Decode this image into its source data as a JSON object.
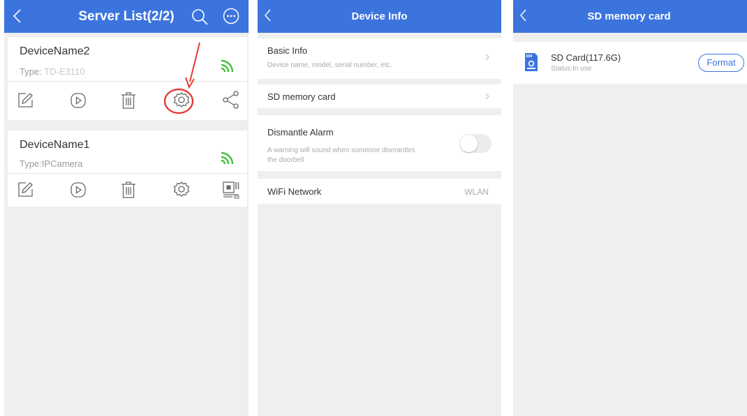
{
  "colors": {
    "accent": "#3c74de",
    "signal": "#3fbf3f",
    "highlight": "#e53935",
    "background": "#efefef"
  },
  "server_list": {
    "title": "Server List(2/2)",
    "icons": [
      "back-icon",
      "search-icon",
      "more-icon"
    ],
    "devices": [
      {
        "name": "DeviceName2",
        "type_label": "Type:",
        "type_value": " TD-E3110",
        "actions": [
          "edit-icon",
          "play-icon",
          "trash-icon",
          "settings-icon",
          "share-icon"
        ]
      },
      {
        "name": "DeviceName1",
        "type_label": "Type:",
        "type_value": "IPCamera",
        "actions": [
          "edit-icon",
          "play-icon",
          "trash-icon",
          "settings-icon",
          "qrcode-icon"
        ]
      }
    ]
  },
  "device_info": {
    "title": "Device Info",
    "basic_info": {
      "label": "Basic Info",
      "description": "Device name, model, serial number, etc."
    },
    "sd_card": {
      "label": "SD memory card"
    },
    "dismantle": {
      "label": "Dismantle Alarm",
      "description_line1": "A warning will sound when someone dismantles",
      "description_line2": "the doorbell",
      "enabled": false
    },
    "wifi": {
      "label": "WiFi Network",
      "value": "WLAN"
    }
  },
  "sd_memory": {
    "title": "SD memory card",
    "card_name": "SD Card(117.6G)",
    "status": "Status:In use",
    "format_label": "Format"
  }
}
